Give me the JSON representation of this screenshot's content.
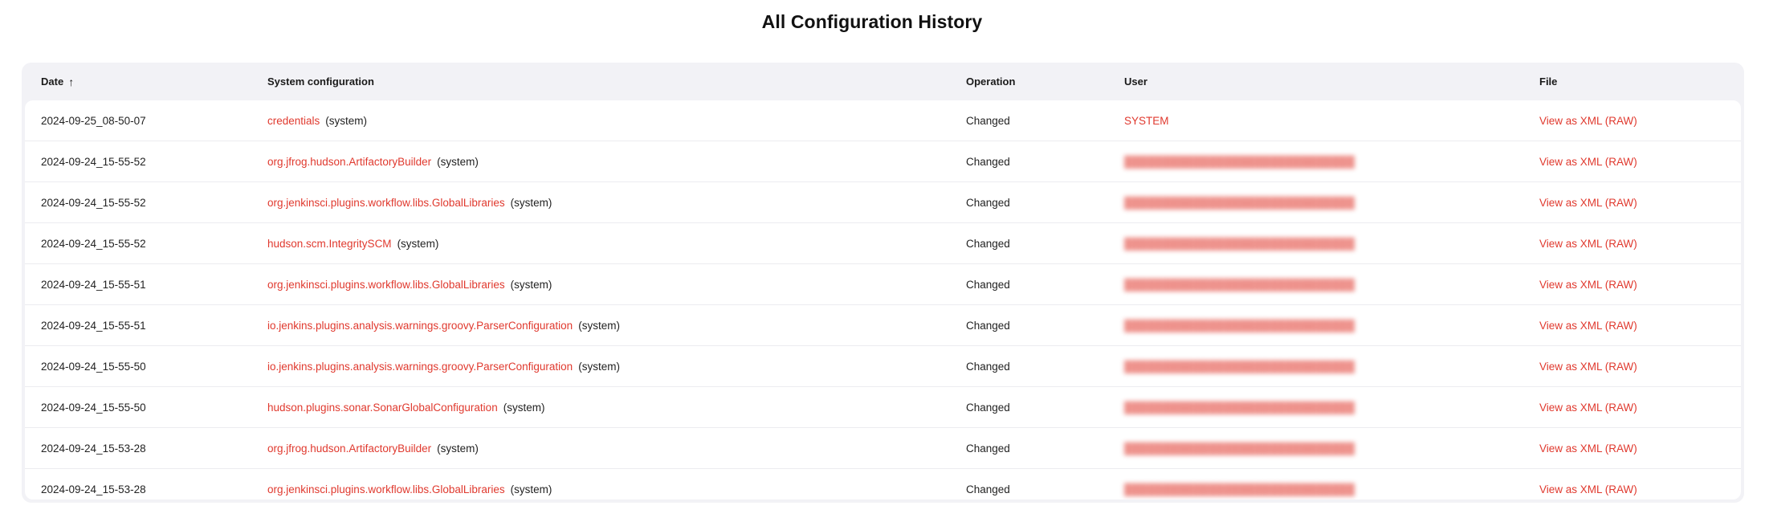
{
  "page": {
    "title": "All Configuration History"
  },
  "table": {
    "columns": {
      "date": "Date",
      "sort_glyph": "↑",
      "config": "System configuration",
      "operation": "Operation",
      "user": "User",
      "file": "File"
    },
    "rows": [
      {
        "date": "2024-09-25_08-50-07",
        "config": "credentials",
        "config_suffix": "(system)",
        "operation": "Changed",
        "user": "SYSTEM",
        "file": "View as XML (RAW)"
      },
      {
        "date": "2024-09-24_15-55-52",
        "config": "org.jfrog.hudson.ArtifactoryBuilder",
        "config_suffix": "(system)",
        "operation": "Changed",
        "user": "",
        "file": "View as XML (RAW)"
      },
      {
        "date": "2024-09-24_15-55-52",
        "config": "org.jenkinsci.plugins.workflow.libs.GlobalLibraries",
        "config_suffix": "(system)",
        "operation": "Changed",
        "user": "",
        "file": "View as XML (RAW)"
      },
      {
        "date": "2024-09-24_15-55-52",
        "config": "hudson.scm.IntegritySCM",
        "config_suffix": "(system)",
        "operation": "Changed",
        "user": "",
        "file": "View as XML (RAW)"
      },
      {
        "date": "2024-09-24_15-55-51",
        "config": "org.jenkinsci.plugins.workflow.libs.GlobalLibraries",
        "config_suffix": "(system)",
        "operation": "Changed",
        "user": "",
        "file": "View as XML (RAW)"
      },
      {
        "date": "2024-09-24_15-55-51",
        "config": "io.jenkins.plugins.analysis.warnings.groovy.ParserConfiguration",
        "config_suffix": "(system)",
        "operation": "Changed",
        "user": "",
        "file": "View as XML (RAW)"
      },
      {
        "date": "2024-09-24_15-55-50",
        "config": "io.jenkins.plugins.analysis.warnings.groovy.ParserConfiguration",
        "config_suffix": "(system)",
        "operation": "Changed",
        "user": "",
        "file": "View as XML (RAW)"
      },
      {
        "date": "2024-09-24_15-55-50",
        "config": "hudson.plugins.sonar.SonarGlobalConfiguration",
        "config_suffix": "(system)",
        "operation": "Changed",
        "user": "",
        "file": "View as XML (RAW)"
      },
      {
        "date": "2024-09-24_15-53-28",
        "config": "org.jfrog.hudson.ArtifactoryBuilder",
        "config_suffix": "(system)",
        "operation": "Changed",
        "user": "",
        "file": "View as XML (RAW)"
      },
      {
        "date": "2024-09-24_15-53-28",
        "config": "org.jenkinsci.plugins.workflow.libs.GlobalLibraries",
        "config_suffix": "(system)",
        "operation": "Changed",
        "user": "",
        "file": "View as XML (RAW)"
      }
    ]
  },
  "colors": {
    "link": "#e0392e",
    "header_bg": "#f2f2f6",
    "row_bg": "#ffffff"
  }
}
